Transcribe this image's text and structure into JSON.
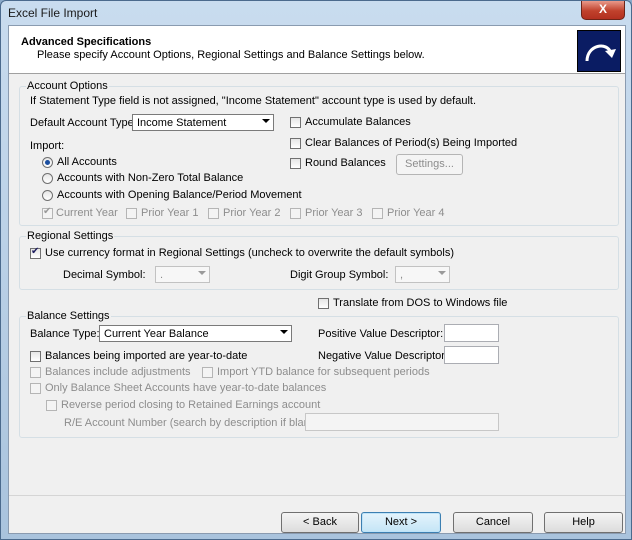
{
  "window": {
    "title": "Excel File Import",
    "close_label": "X"
  },
  "header": {
    "title": "Advanced Specifications",
    "subtitle": "Please specify Account Options, Regional Settings and Balance Settings below."
  },
  "account_options": {
    "group_label": "Account Options",
    "note": "If Statement Type field is not assigned, \"Income Statement\" account type is used by default.",
    "default_account_type_label": "Default Account Type:",
    "default_account_type_value": "Income Statement",
    "import_label": "Import:",
    "radios": [
      "All Accounts",
      "Accounts with Non-Zero Total Balance",
      "Accounts with Opening Balance/Period Movement"
    ],
    "years": [
      "Current Year",
      "Prior Year 1",
      "Prior Year 2",
      "Prior Year 3",
      "Prior Year 4"
    ],
    "accumulate_balances": "Accumulate Balances",
    "clear_balances": "Clear Balances of Period(s) Being Imported",
    "round_balances": "Round Balances",
    "settings_button": "Settings..."
  },
  "regional": {
    "group_label": "Regional Settings",
    "use_currency": "Use currency format in Regional Settings (uncheck to overwrite the default symbols)",
    "decimal_symbol_label": "Decimal Symbol:",
    "decimal_symbol_value": ".",
    "digit_group_label": "Digit Group Symbol:",
    "digit_group_value": ","
  },
  "balance": {
    "translate_dos": "Translate from DOS to Windows file",
    "group_label": "Balance Settings",
    "balance_type_label": "Balance Type:",
    "balance_type_value": "Current Year Balance",
    "positive_label": "Positive Value Descriptor:",
    "negative_label": "Negative Value Descriptor:",
    "ytd": "Balances being imported are year-to-date",
    "include_adjustments": "Balances include adjustments",
    "import_ytd": "Import YTD balance for subsequent periods",
    "only_bs": "Only Balance Sheet Accounts have year-to-date balances",
    "reverse_closing": "Reverse period closing to Retained Earnings account",
    "re_account_label": "R/E Account Number (search by description if blank):"
  },
  "footer": {
    "back": "< Back",
    "next": "Next >",
    "cancel": "Cancel",
    "help": "Help"
  },
  "colors": {
    "logo_bg": "#0a1c63",
    "close_red": "#c0412c",
    "primary_border": "#3c7fb1"
  }
}
